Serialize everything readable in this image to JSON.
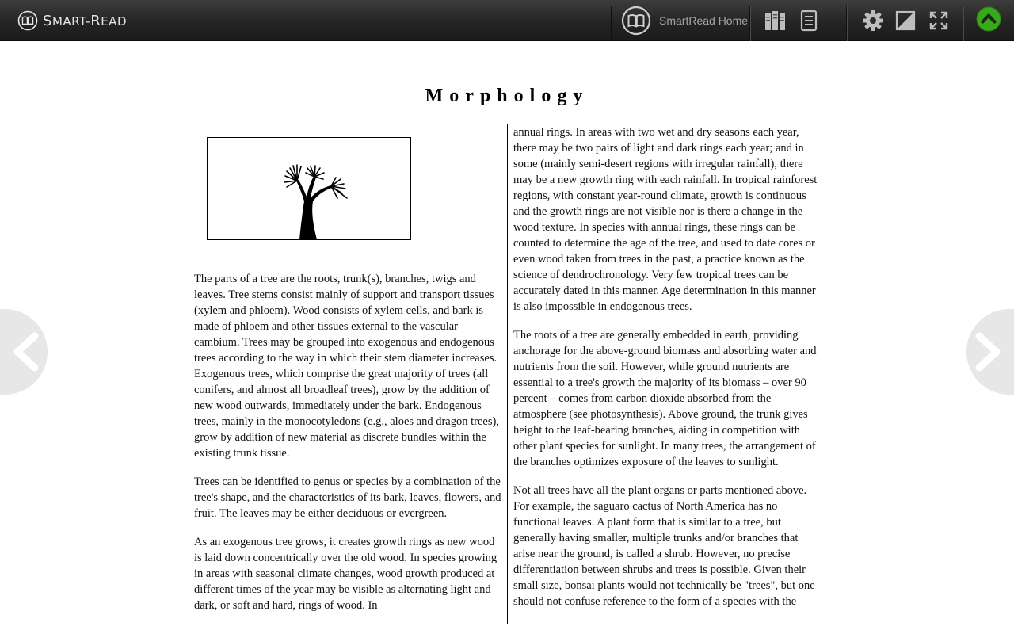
{
  "app": {
    "logo_text_first": "S",
    "logo_text_rest": "MART",
    "logo_text_dash": "-",
    "logo_text_second": "R",
    "logo_text_last": "EAD"
  },
  "toolbar": {
    "home_label": "SmartRead Home",
    "icons": [
      "book-icon",
      "library-icon",
      "toc-icon",
      "gear-icon",
      "contrast-icon",
      "fullscreen-icon",
      "scroll-up-icon"
    ],
    "accent_color": "#3aa81e"
  },
  "article": {
    "title": "Morphology",
    "left_paragraphs": [
      "The parts of a tree are the roots, trunk(s), branches, twigs and leaves. Tree stems consist mainly of support and transport tissues (xylem and phloem). Wood consists of xylem cells, and bark is made of phloem and other tissues external to the vascular cambium. Trees may be grouped into exogenous and endogenous trees according to the way in which their stem diameter increases. Exogenous trees, which comprise the great majority of trees (all conifers, and almost all broadleaf trees), grow by the addition of new wood outwards, immediately under the bark. Endogenous trees, mainly in the monocotyledons (e.g., aloes and dragon trees), grow by addition of new material as discrete bundles within the existing trunk tissue.",
      "Trees can be identified to genus or species by a combination of the tree's shape, and the characteristics of its bark, leaves, flowers, and fruit. The leaves may be either deciduous or evergreen.",
      "As an exogenous tree grows, it creates growth rings as new wood is laid down concentrically over the old wood. In species growing in areas with seasonal climate changes, wood growth produced at different times of the year may be visible as alternating light and dark, or soft and hard, rings of wood. In"
    ],
    "right_paragraphs": [
      "annual rings. In areas with two wet and dry seasons each year, there may be two pairs of light and dark rings each year; and in some (mainly semi-desert regions with irregular rainfall), there may be a new growth ring with each rainfall. In tropical rainforest regions, with constant year-round climate, growth is continuous and the growth rings are not visible nor is there a change in the wood texture. In species with annual rings, these rings can be counted to determine the age of the tree, and used to date cores or even wood taken from trees in the past, a practice known as the science of dendrochronology. Very few tropical trees can be accurately dated in this manner. Age determination in this manner is also impossible in endogenous trees.",
      "The roots of a tree are generally embedded in earth, providing anchorage for the above-ground biomass and absorbing water and nutrients from the soil. However, while ground nutrients are essential to a tree's growth the majority of its biomass – over 90 percent – comes from carbon dioxide absorbed from the atmosphere (see photosynthesis). Above ground, the trunk gives height to the leaf-bearing branches, aiding in competition with other plant species for sunlight. In many trees, the arrangement of the branches optimizes exposure of the leaves to sunlight.",
      "Not all trees have all the plant organs or parts mentioned above. For example, the saguaro cactus of North America has no functional leaves. A plant form that is similar to a tree, but generally having smaller, multiple trunks and/or branches that arise near the ground, is called a shrub. However, no precise differentiation between shrubs and trees is possible. Given their small size, bonsai plants would not technically be \"trees\", but one should not confuse reference to the form of a species with the"
    ]
  },
  "navigation": {
    "prev_icon": "chevron-left-icon",
    "next_icon": "chevron-right-icon"
  }
}
